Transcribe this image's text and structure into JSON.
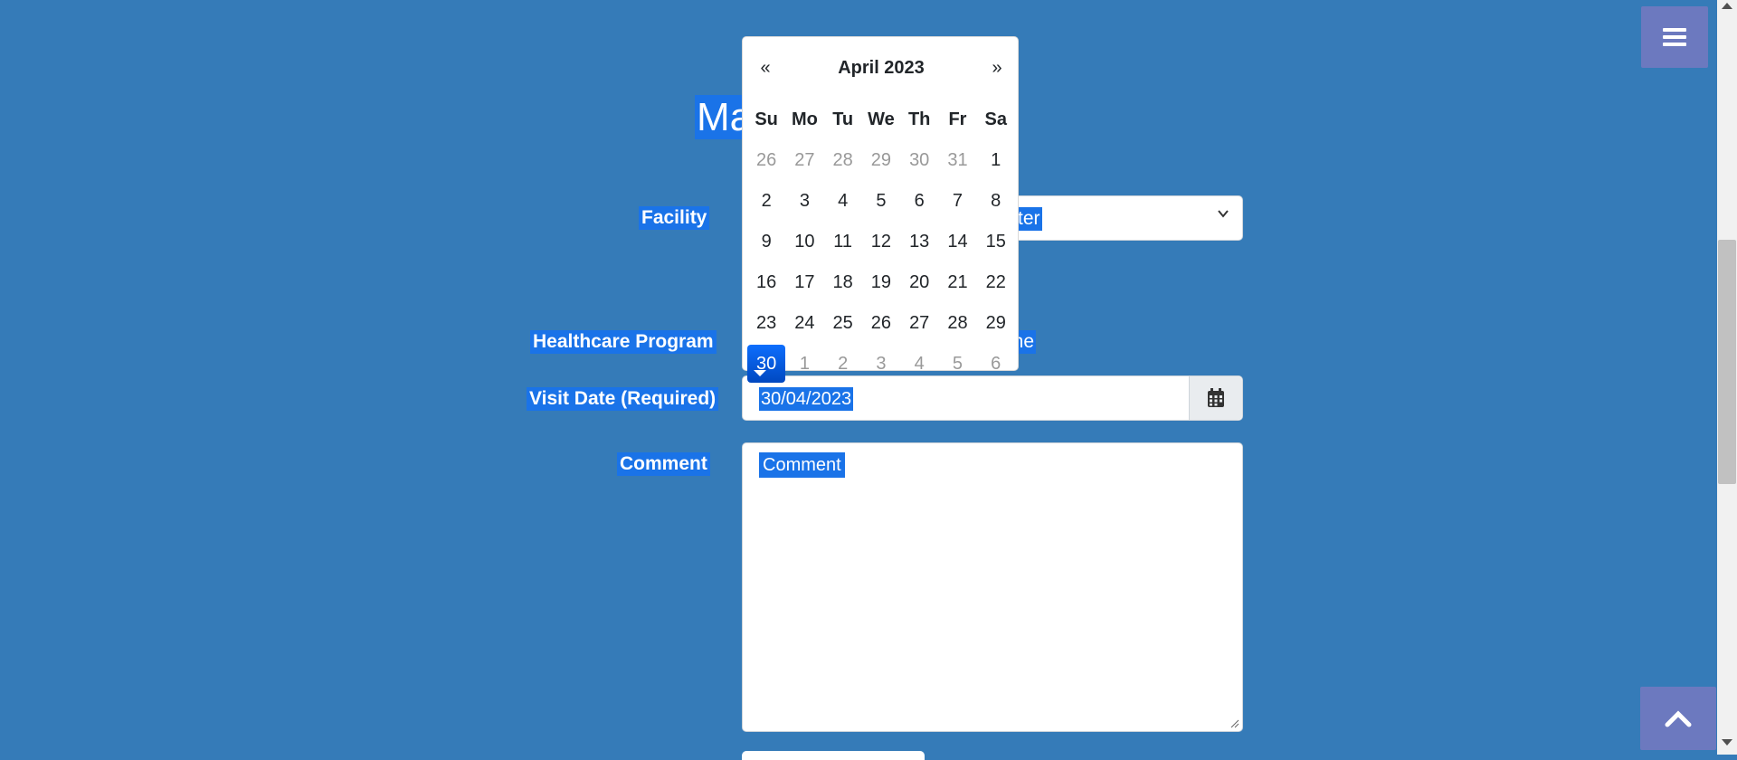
{
  "page": {
    "title_visible": "Ma",
    "facility_label": "Facility",
    "facility_value_visible": "ter",
    "healthcare_program_label": "Healthcare Program",
    "healthcare_program_value_visible": "one",
    "visit_date_label": "Visit Date (Required)",
    "visit_date_value": "30/04/2023",
    "comment_label": "Comment",
    "comment_placeholder": "Comment"
  },
  "datepicker": {
    "prev": "«",
    "next": "»",
    "month_title": "April 2023",
    "weekdays": [
      "Su",
      "Mo",
      "Tu",
      "We",
      "Th",
      "Fr",
      "Sa"
    ],
    "weeks": [
      [
        "26",
        "27",
        "28",
        "29",
        "30",
        "31",
        "1"
      ],
      [
        "2",
        "3",
        "4",
        "5",
        "6",
        "7",
        "8"
      ],
      [
        "9",
        "10",
        "11",
        "12",
        "13",
        "14",
        "15"
      ],
      [
        "16",
        "17",
        "18",
        "19",
        "20",
        "21",
        "22"
      ],
      [
        "23",
        "24",
        "25",
        "26",
        "27",
        "28",
        "29"
      ],
      [
        "30",
        "1",
        "2",
        "3",
        "4",
        "5",
        "6"
      ]
    ],
    "selected": "30"
  },
  "icons": {
    "menu": "hamburger-icon",
    "calendar": "calendar-icon",
    "scroll_top": "chevron-up-icon",
    "select": "chevron-down-icon"
  },
  "colors": {
    "background": "#357bb8",
    "selection": "#1a73e8",
    "fab": "#6c79bf",
    "active_day": "#0d6efd"
  }
}
